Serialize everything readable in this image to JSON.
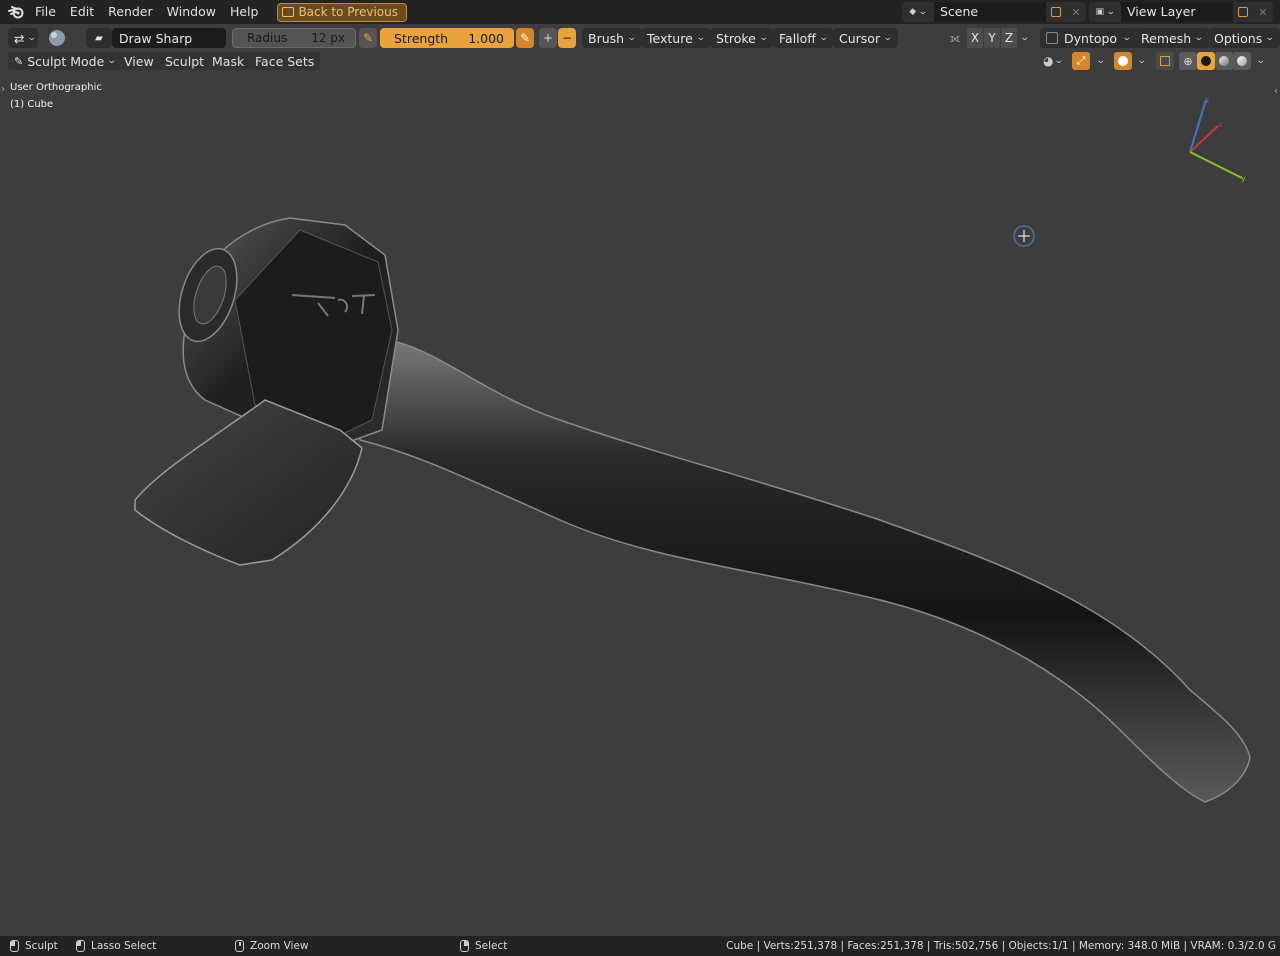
{
  "menu": [
    "File",
    "Edit",
    "Render",
    "Window",
    "Help"
  ],
  "back_to_previous": "Back to Previous",
  "scene": {
    "name": "Scene"
  },
  "view_layer": {
    "name": "View Layer"
  },
  "tool_header": {
    "brush_name": "Draw Sharp",
    "radius_label": "Radius",
    "radius_value": "12 px",
    "strength_label": "Strength",
    "strength_value": "1.000",
    "plus": "+",
    "minus": "−",
    "menus": [
      "Brush",
      "Texture",
      "Stroke",
      "Falloff",
      "Cursor"
    ],
    "axes": [
      "X",
      "Y",
      "Z"
    ],
    "right_menus": [
      "Dyntopo",
      "Remesh",
      "Options"
    ]
  },
  "mode_header": {
    "mode": "Sculpt Mode",
    "menus": [
      "View",
      "Sculpt",
      "Mask",
      "Face Sets"
    ]
  },
  "viewport": {
    "view_name": "User Orthographic",
    "object_name": "(1) Cube",
    "gizmo_axes": {
      "z": "z",
      "x": "x",
      "y": "y"
    },
    "colors": {
      "x_axis": "#c23a3a",
      "y_axis": "#8fbf2a",
      "z_axis": "#3d78c8"
    }
  },
  "status": {
    "sculpt": "Sculpt",
    "lasso": "Lasso Select",
    "zoom": "Zoom View",
    "select": "Select",
    "stats": "Cube | Verts:251,378 | Faces:251,378 | Tris:502,756 | Objects:1/1 | Memory: 348.0 MiB | VRAM: 0.3/2.0 G"
  },
  "colors": {
    "accent": "#e8a33a",
    "header_bg": "#232323",
    "viewport_bg": "#3d3d3d"
  }
}
